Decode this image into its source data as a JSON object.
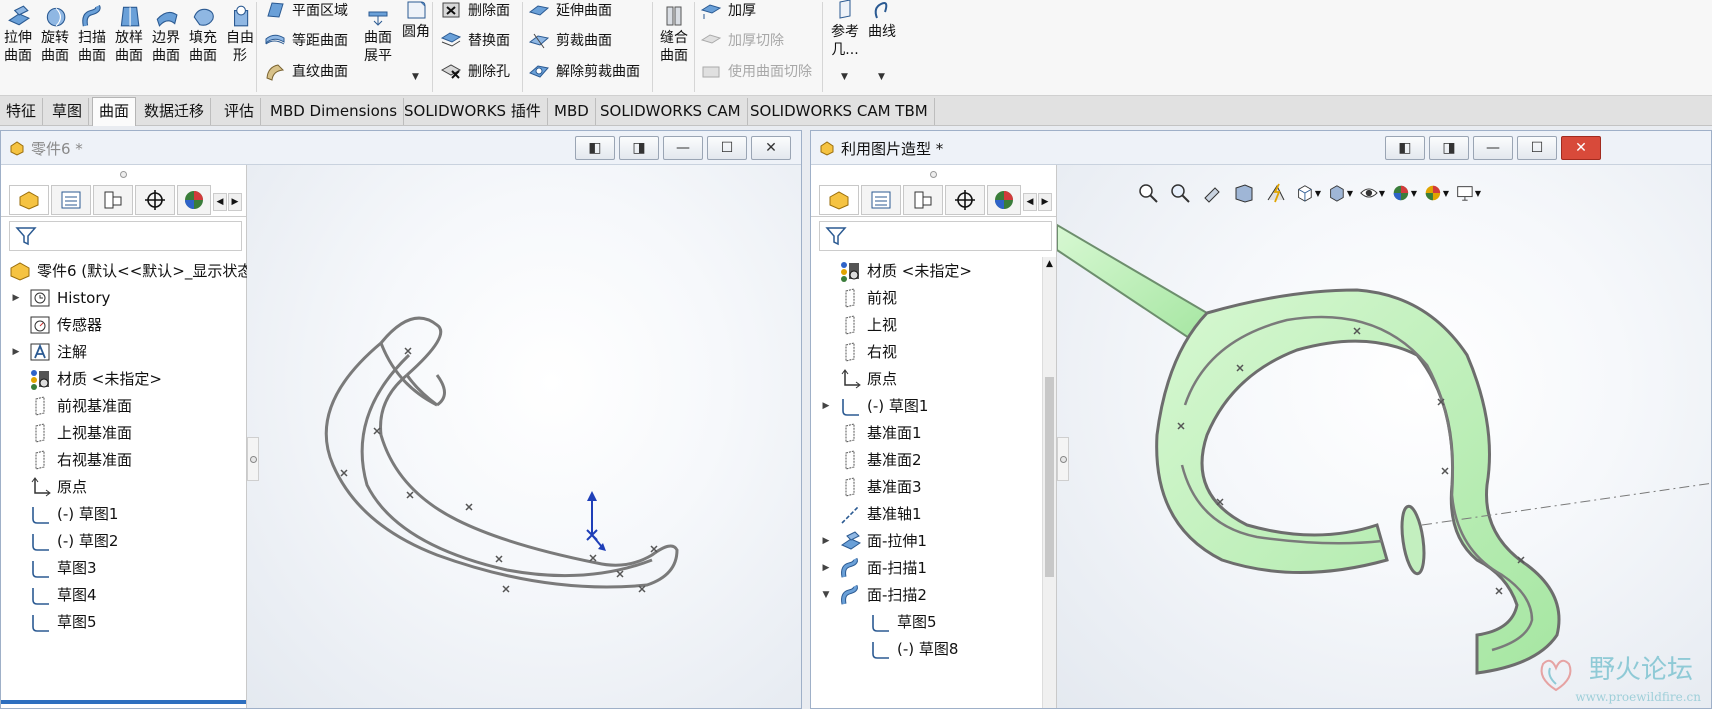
{
  "ribbon": {
    "big_buttons": [
      {
        "line1": "拉伸",
        "line2": "曲面",
        "icon": "extruded-surface-icon"
      },
      {
        "line1": "旋转",
        "line2": "曲面",
        "icon": "revolved-surface-icon"
      },
      {
        "line1": "扫描",
        "line2": "曲面",
        "icon": "swept-surface-icon"
      },
      {
        "line1": "放样",
        "line2": "曲面",
        "icon": "lofted-surface-icon"
      },
      {
        "line1": "边界",
        "line2": "曲面",
        "icon": "boundary-surface-icon"
      },
      {
        "line1": "填充",
        "line2": "曲面",
        "icon": "filled-surface-icon"
      },
      {
        "line1": "自由",
        "line2": "形",
        "icon": "freeform-icon"
      }
    ],
    "col_a": [
      "平面区域",
      "等距曲面",
      "直纹曲面"
    ],
    "flatten": {
      "line1": "曲面",
      "line2": "展平"
    },
    "fillet": "圆角",
    "col_b": [
      "删除面",
      "替换面",
      "删除孔"
    ],
    "col_c": [
      "延伸曲面",
      "剪裁曲面",
      "解除剪裁曲面"
    ],
    "knit": {
      "line1": "缝合",
      "line2": "曲面"
    },
    "col_d": [
      {
        "label": "加厚",
        "enabled": true
      },
      {
        "label": "加厚切除",
        "enabled": false
      },
      {
        "label": "使用曲面切除",
        "enabled": false
      }
    ],
    "ref_geom": {
      "line1": "参考",
      "line2": "几..."
    },
    "curves": "曲线"
  },
  "tabs": [
    {
      "label": "特征",
      "active": false
    },
    {
      "label": "草图",
      "active": false
    },
    {
      "label": "曲面",
      "active": true
    },
    {
      "label": "数据迁移",
      "active": false
    },
    {
      "label": "评估",
      "active": false
    },
    {
      "label": "MBD Dimensions",
      "active": false
    },
    {
      "label": "SOLIDWORKS 插件",
      "active": false
    },
    {
      "label": "MBD",
      "active": false
    },
    {
      "label": "SOLIDWORKS CAM",
      "active": false
    },
    {
      "label": "SOLIDWORKS CAM TBM",
      "active": false
    }
  ],
  "left_doc": {
    "title": "零件6 *",
    "tree_root": "零件6  (默认<<默认>_显示状态",
    "tree": [
      {
        "label": "History",
        "icon": "history-icon",
        "expandable": true
      },
      {
        "label": "传感器",
        "icon": "sensor-icon",
        "expandable": false
      },
      {
        "label": "注解",
        "icon": "annotation-icon",
        "expandable": true
      },
      {
        "label": "材质 <未指定>",
        "icon": "material-icon",
        "expandable": false
      },
      {
        "label": "前视基准面",
        "icon": "plane-icon",
        "expandable": false
      },
      {
        "label": "上视基准面",
        "icon": "plane-icon",
        "expandable": false
      },
      {
        "label": "右视基准面",
        "icon": "plane-icon",
        "expandable": false
      },
      {
        "label": "原点",
        "icon": "origin-icon",
        "expandable": false
      },
      {
        "label": "(-) 草图1",
        "icon": "sketch-icon",
        "expandable": false
      },
      {
        "label": "(-) 草图2",
        "icon": "sketch-icon",
        "expandable": false
      },
      {
        "label": "草图3",
        "icon": "sketch-icon",
        "expandable": false
      },
      {
        "label": "草图4",
        "icon": "sketch-icon",
        "expandable": false
      },
      {
        "label": "草图5",
        "icon": "sketch-icon",
        "expandable": false
      }
    ]
  },
  "right_doc": {
    "title": "利用图片造型 *",
    "tree": [
      {
        "label": "材质 <未指定>",
        "icon": "material-icon",
        "expandable": false
      },
      {
        "label": "前视",
        "icon": "plane-icon",
        "expandable": false
      },
      {
        "label": "上视",
        "icon": "plane-icon",
        "expandable": false
      },
      {
        "label": "右视",
        "icon": "plane-icon",
        "expandable": false
      },
      {
        "label": "原点",
        "icon": "origin-icon",
        "expandable": false
      },
      {
        "label": "(-) 草图1",
        "icon": "sketch-icon",
        "expandable": true
      },
      {
        "label": "基准面1",
        "icon": "plane-icon",
        "expandable": false
      },
      {
        "label": "基准面2",
        "icon": "plane-icon",
        "expandable": false
      },
      {
        "label": "基准面3",
        "icon": "plane-icon",
        "expandable": false
      },
      {
        "label": "基准轴1",
        "icon": "axis-icon",
        "expandable": false
      },
      {
        "label": "面-拉伸1",
        "icon": "extruded-surface-icon",
        "expandable": true
      },
      {
        "label": "面-扫描1",
        "icon": "swept-surface-icon",
        "expandable": true
      },
      {
        "label": "面-扫描2",
        "icon": "swept-surface-icon",
        "expandable": true,
        "expanded": true
      },
      {
        "label": "草图5",
        "icon": "sketch-icon",
        "expandable": false,
        "child": true
      },
      {
        "label": "(-) 草图8",
        "icon": "sketch-icon",
        "expandable": false,
        "child": true
      }
    ]
  },
  "watermark": {
    "cn": "野火论坛",
    "url": "www.proewildfire.cn"
  },
  "colors": {
    "accent": "#2e6fbf",
    "surface_green": "#b8f0b8",
    "curve_gray": "#7a7a7a"
  }
}
